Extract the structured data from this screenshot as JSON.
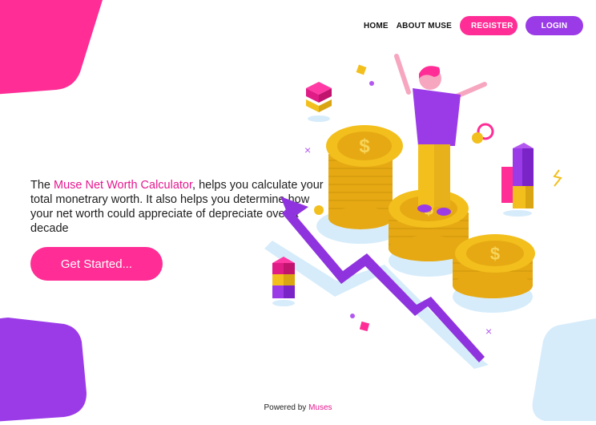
{
  "nav": {
    "home": "HOME",
    "about": "ABOUT MUSE",
    "register": "REGISTER",
    "login": "LOGIN"
  },
  "hero": {
    "prefix": "The ",
    "app_name": "Muse Net Worth Calculator",
    "line_rest": ", helps you calculate your total monetrary worth. It also helps you determine how your net worth could appreciate of depreciate over a decade",
    "cta": "Get Started..."
  },
  "footer": {
    "prefix": "Powered by ",
    "brand": "Muses"
  },
  "colors": {
    "pink": "#ff2d95",
    "purple": "#9b3be8",
    "light_blue": "#d6ecfb",
    "gold": "#f2bf1d"
  }
}
